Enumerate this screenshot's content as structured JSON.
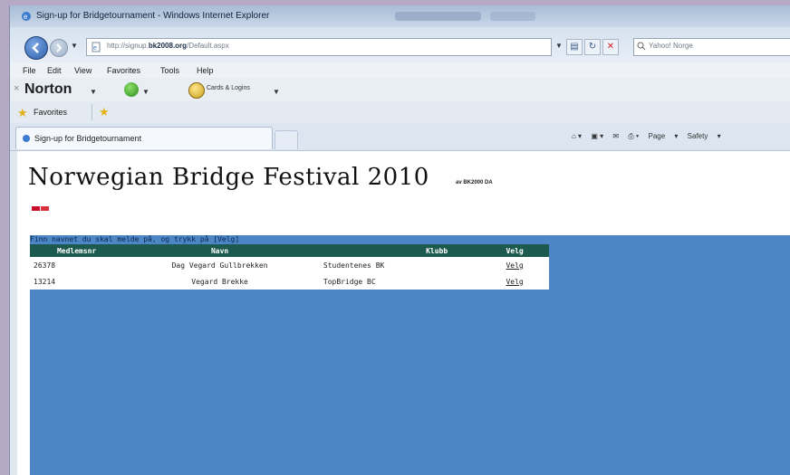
{
  "window": {
    "title": "Sign-up for Bridgetournament - Windows Internet Explorer"
  },
  "address": {
    "url_prefix": "http://signup.",
    "url_domain": "bk2008.org",
    "url_path": "/Default.aspx"
  },
  "search": {
    "placeholder": "Yahoo! Norge"
  },
  "menu": {
    "items": [
      "File",
      "Edit",
      "View",
      "Favorites",
      "Tools",
      "Help"
    ]
  },
  "norton": {
    "brand": "Norton",
    "cards_label": "Cards & Logins"
  },
  "favorites": {
    "label": "Favorites"
  },
  "tab": {
    "label": "Sign-up for Bridgetournament"
  },
  "commandbar": {
    "items": [
      "Page",
      "Safety"
    ]
  },
  "page": {
    "title": "Norwegian Bridge Festival 2010",
    "subtitle": "av BK2000 DA",
    "instruction": "Finn navnet du skal melde på, og trykk på [Velg]"
  },
  "table": {
    "headers": [
      "Medlemsnr",
      "Navn",
      "Klubb",
      "Velg"
    ],
    "rows": [
      {
        "medlemsnr": "26378",
        "navn": "Dag Vegard Gullbrekken",
        "klubb": "Studentenes BK",
        "velg": "Velg"
      },
      {
        "medlemsnr": "13214",
        "navn": "Vegard Brekke",
        "klubb": "TopBridge BC",
        "velg": "Velg"
      }
    ]
  }
}
